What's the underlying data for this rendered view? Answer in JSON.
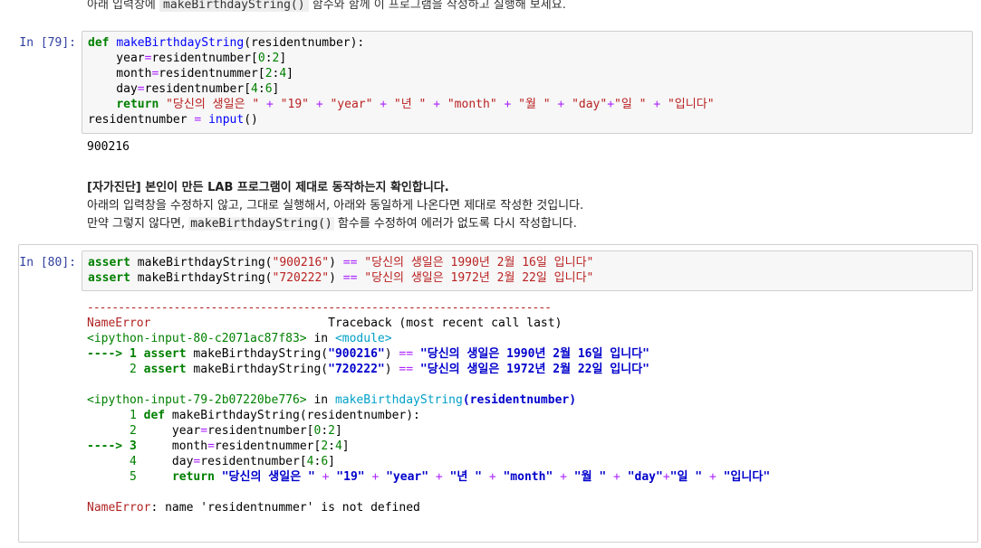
{
  "top_text": {
    "before": "아래 입력창에",
    "code": "makeBirthdayString()",
    "after": "함수와 함께 이 프로그램을 작성하고 실행해 보세요."
  },
  "cell79": {
    "prompt": "In [79]:",
    "output": "900216"
  },
  "markdown": {
    "bold": "[자가진단] 본인이 만든 LAB 프로그램이 제대로 동작하는지 확인합니다.",
    "line2": "아래의 입력창을 수정하지 않고, 그대로 실행해서, 아래와 동일하게 나온다면 제대로 작성한 것입니다.",
    "line3_before": "만약 그렇지 않다면,",
    "line3_code": "makeBirthdayString()",
    "line3_after": "함수를 수정하여 에러가 없도록 다시 작성합니다."
  },
  "cell80": {
    "prompt": "In [80]:"
  },
  "traceback": {
    "dashes": "---------------------------------------------------------------------------",
    "error_name": "NameError",
    "header_right": "Traceback (most recent call last)",
    "frame1_file": "<ipython-input-80-c2071ac87f83>",
    "frame1_in": "in",
    "frame1_module": "<module>",
    "frame2_file": "<ipython-input-79-2b07220be776>",
    "frame2_in": "in",
    "frame2_func": "makeBirthdayString",
    "frame2_args": "(residentnumber)",
    "final_name": "NameError",
    "final_msg": ": name 'residentnummer' is not defined"
  }
}
